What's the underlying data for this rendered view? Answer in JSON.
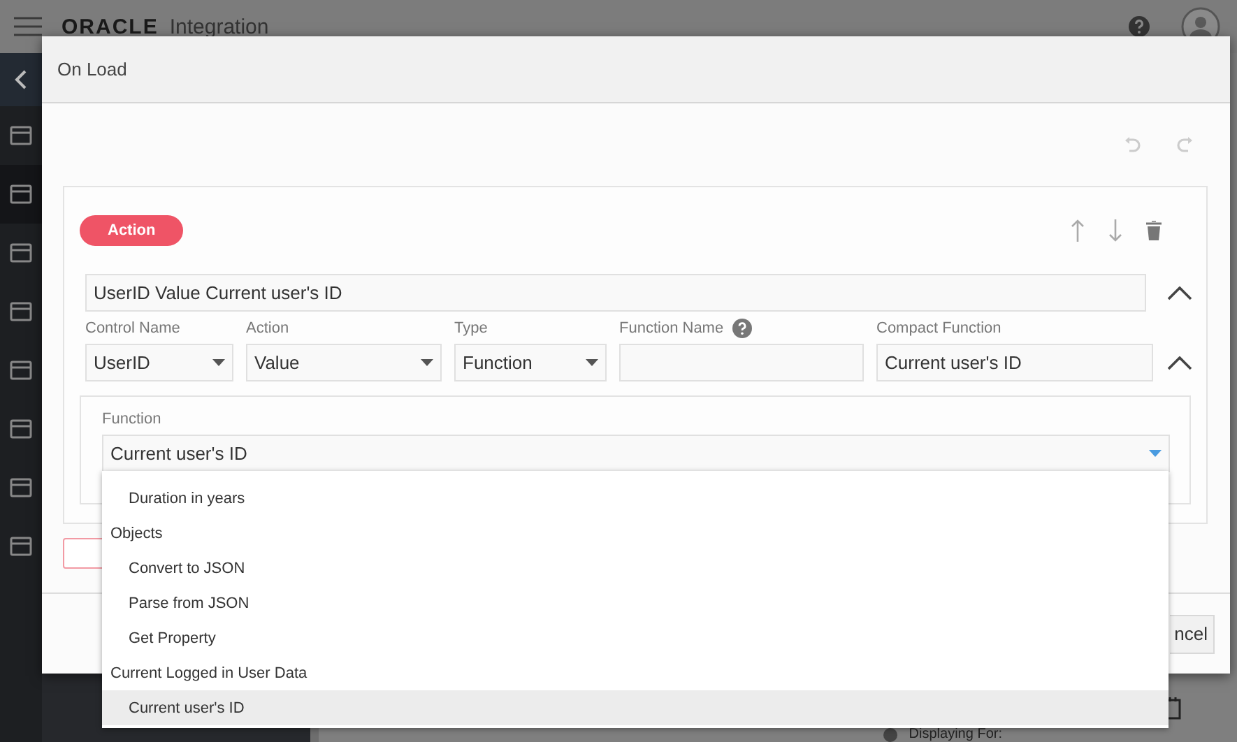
{
  "app": {
    "brand": "ORACLE",
    "product": "Integration",
    "status_label": "Displaying For:"
  },
  "dialog": {
    "title": "On Load",
    "rule": {
      "badge": "Action",
      "summary": "UserID Value Current user's ID",
      "fields": [
        {
          "label": "Control Name",
          "value": "UserID",
          "kind": "select"
        },
        {
          "label": "Action",
          "value": "Value",
          "kind": "select"
        },
        {
          "label": "Type",
          "value": "Function",
          "kind": "select"
        },
        {
          "label": "Function Name",
          "kind": "text",
          "help": true
        },
        {
          "label": "Compact Function",
          "value": "Current user's ID",
          "kind": "text"
        }
      ],
      "function": {
        "label": "Function",
        "value": "Current user's ID",
        "expanded": true,
        "options": [
          {
            "label": "Duration in years",
            "kind": "option",
            "selected": false
          },
          {
            "label": "Objects",
            "kind": "group",
            "selected": false
          },
          {
            "label": "Convert to JSON",
            "kind": "option",
            "selected": false
          },
          {
            "label": "Parse from JSON",
            "kind": "option",
            "selected": false
          },
          {
            "label": "Get Property",
            "kind": "option",
            "selected": false
          },
          {
            "label": "Current Logged in User Data",
            "kind": "group",
            "selected": false
          },
          {
            "label": "Current user's ID",
            "kind": "option",
            "selected": true
          }
        ]
      }
    },
    "cancel": "ncel"
  }
}
